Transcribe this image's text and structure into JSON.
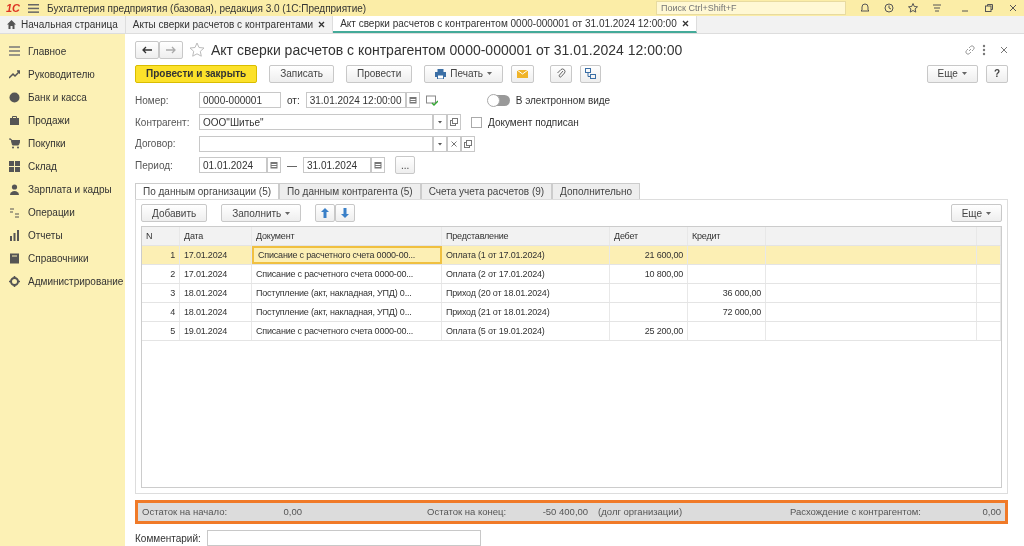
{
  "app": {
    "title": "Бухгалтерия предприятия (базовая), редакция 3.0  (1С:Предприятие)",
    "logo": "1С",
    "search": {
      "placeholder": "Поиск Ctrl+Shift+F"
    }
  },
  "open_tabs": [
    {
      "label": "Начальная страница",
      "kind": "home",
      "selected": false
    },
    {
      "label": "Акты сверки расчетов с контрагентами",
      "kind": "doc",
      "selected": false
    },
    {
      "label": "Акт сверки расчетов с контрагентом 0000-000001 от 31.01.2024 12:00:00",
      "kind": "doc",
      "selected": true
    }
  ],
  "sidebar": {
    "items": [
      {
        "label": "Главное"
      },
      {
        "label": "Руководителю"
      },
      {
        "label": "Банк и касса"
      },
      {
        "label": "Продажи"
      },
      {
        "label": "Покупки"
      },
      {
        "label": "Склад"
      },
      {
        "label": "Зарплата и кадры"
      },
      {
        "label": "Операции"
      },
      {
        "label": "Отчеты"
      },
      {
        "label": "Справочники"
      },
      {
        "label": "Администрирование"
      }
    ]
  },
  "form": {
    "title": "Акт сверки расчетов с контрагентом 0000-000001 от 31.01.2024 12:00:00",
    "toolbar": {
      "primary": "Провести и закрыть",
      "buttons": [
        "Записать",
        "Провести"
      ],
      "print": "Печать",
      "more": "Еще",
      "help": "?"
    },
    "fields": {
      "number": {
        "label": "Номер:",
        "value": "0000-000001"
      },
      "date": {
        "label": "от:",
        "value": "31.01.2024 12:00:00"
      },
      "electronic": {
        "label": "В электронном виде",
        "on": false
      },
      "counterparty": {
        "label": "Контрагент:",
        "value": "ООО\"Шитье\""
      },
      "signed": {
        "label": "Документ подписан",
        "checked": false
      },
      "contract": {
        "label": "Договор:"
      },
      "period": {
        "label": "Период:",
        "from": "01.01.2024",
        "dash": "—",
        "to": "31.01.2024",
        "more": "..."
      }
    },
    "tabs": [
      {
        "label": "По данным организации (5)",
        "selected": true
      },
      {
        "label": "По данным контрагента (5)",
        "selected": false
      },
      {
        "label": "Счета учета расчетов (9)",
        "selected": false
      },
      {
        "label": "Дополнительно",
        "selected": false
      }
    ],
    "table_toolbar": {
      "add": "Добавить",
      "fill": "Заполнить",
      "more": "Еще"
    },
    "table": {
      "columns": [
        "N",
        "Дата",
        "Документ",
        "Представление",
        "Дебет",
        "Кредит"
      ],
      "rows": [
        {
          "n": "1",
          "date": "17.01.2024",
          "document": "Списание с расчетного счета 0000-00...",
          "description": "Оплата (1 от 17.01.2024)",
          "debit": "21 600,00",
          "credit": "",
          "selected": true
        },
        {
          "n": "2",
          "date": "17.01.2024",
          "document": "Списание с расчетного счета 0000-00...",
          "description": "Оплата (2 от 17.01.2024)",
          "debit": "10 800,00",
          "credit": "",
          "selected": false
        },
        {
          "n": "3",
          "date": "18.01.2024",
          "document": "Поступление (акт, накладная, УПД) 0...",
          "description": "Приход (20 от 18.01.2024)",
          "debit": "",
          "credit": "36 000,00",
          "selected": false
        },
        {
          "n": "4",
          "date": "18.01.2024",
          "document": "Поступление (акт, накладная, УПД) 0...",
          "description": "Приход (21 от 18.01.2024)",
          "debit": "",
          "credit": "72 000,00",
          "selected": false
        },
        {
          "n": "5",
          "date": "19.01.2024",
          "document": "Списание с расчетного счета 0000-00...",
          "description": "Оплата (5 от 19.01.2024)",
          "debit": "25 200,00",
          "credit": "",
          "selected": false
        }
      ]
    },
    "totals": {
      "start_label": "Остаток на начало:",
      "start": "0,00",
      "end_label": "Остаток на конец:",
      "end": "-50 400,00",
      "end_note": "(долг организации)",
      "diff_label": "Расхождение с контрагентом:",
      "diff": "0,00"
    },
    "comment": {
      "label": "Комментарий:"
    }
  }
}
